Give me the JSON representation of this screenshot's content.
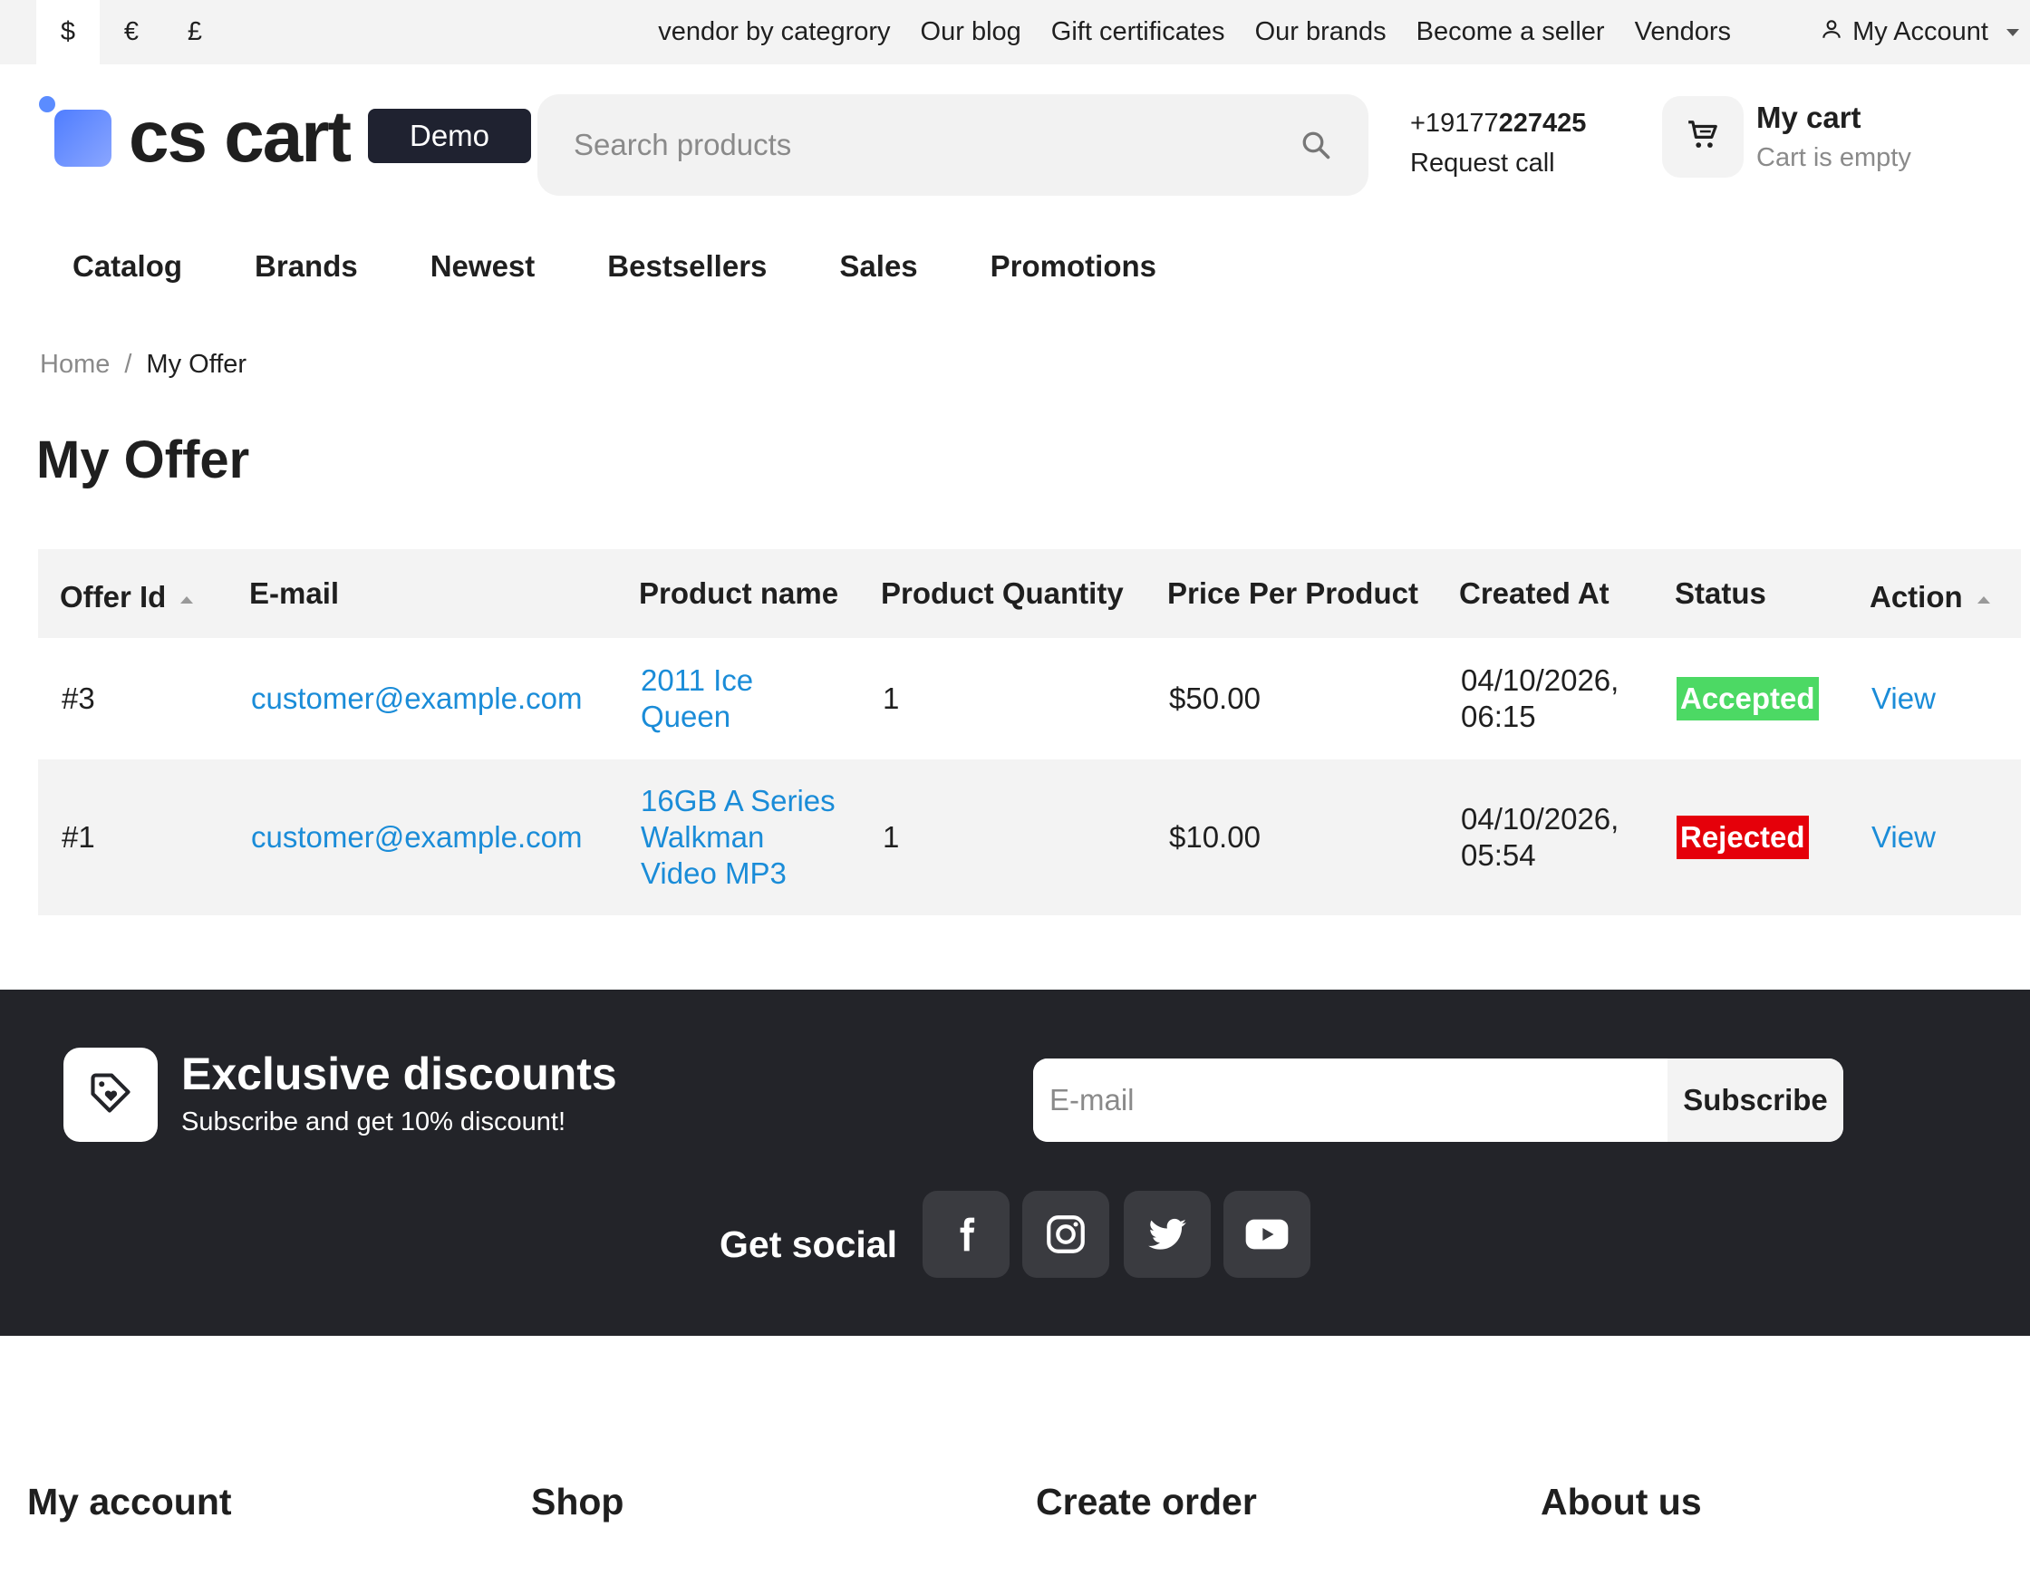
{
  "currencies": [
    "$",
    "€",
    "£"
  ],
  "top_links": [
    "vendor by categrory",
    "Our blog",
    "Gift certificates",
    "Our brands",
    "Become a seller",
    "Vendors"
  ],
  "account_label": "My Account",
  "logo": {
    "word": "cs cart",
    "badge": "Demo"
  },
  "search": {
    "placeholder": "Search products"
  },
  "contact": {
    "phone_prefix": "+19177",
    "phone_bold": "227425",
    "request_call": "Request call"
  },
  "cart": {
    "title": "My cart",
    "status": "Cart is empty"
  },
  "nav": [
    "Catalog",
    "Brands",
    "Newest",
    "Bestsellers",
    "Sales",
    "Promotions"
  ],
  "breadcrumb": {
    "home": "Home",
    "separator": "/",
    "current": "My Offer"
  },
  "page_title": "My Offer",
  "table": {
    "headers": [
      "Offer Id",
      "E-mail",
      "Product name",
      "Product Quantity",
      "Price Per Product",
      "Created At",
      "Status",
      "Action"
    ],
    "rows": [
      {
        "id": "#3",
        "email": "customer@example.com",
        "product_line1": "2011 Ice",
        "product_line2": "Queen",
        "product_line3": "",
        "qty": "1",
        "price": "$50.00",
        "created_line1": "04/10/2026,",
        "created_line2": "06:15",
        "status": "Accepted",
        "status_color": "#4cd964",
        "action": "View"
      },
      {
        "id": "#1",
        "email": "customer@example.com",
        "product_line1": "16GB A Series",
        "product_line2": "Walkman",
        "product_line3": "Video MP3",
        "qty": "1",
        "price": "$10.00",
        "created_line1": "04/10/2026,",
        "created_line2": "05:54",
        "status": "Rejected",
        "status_color": "#e5000a",
        "action": "View"
      }
    ]
  },
  "promo": {
    "title": "Exclusive discounts",
    "subtitle": "Subscribe and get 10% discount!",
    "email_placeholder": "E-mail",
    "subscribe": "Subscribe"
  },
  "social": {
    "label": "Get social",
    "icons": [
      "facebook-icon",
      "instagram-icon",
      "twitter-icon",
      "youtube-icon"
    ]
  },
  "footer_columns": [
    "My account",
    "Shop",
    "Create order",
    "About us"
  ],
  "colors": {
    "link": "#1a8cd8",
    "dark_bg": "#232429",
    "accepted": "#4cd964",
    "rejected": "#e5000a"
  }
}
